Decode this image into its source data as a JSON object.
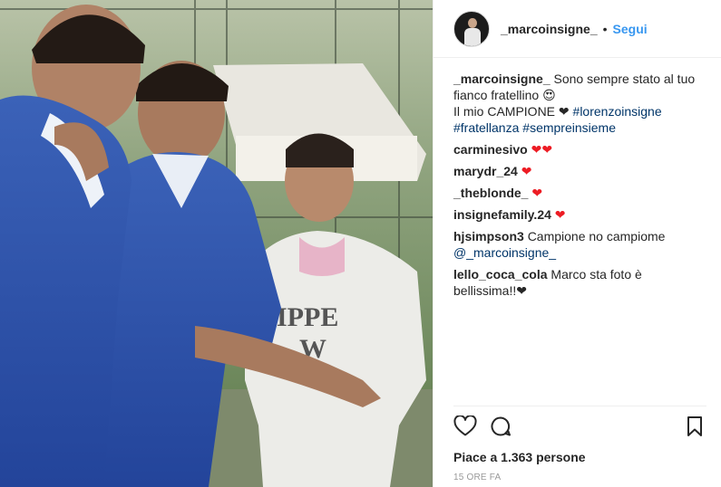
{
  "post": {
    "username": "_marcoinsigne_",
    "separator": "•",
    "follow_label": "Segui"
  },
  "caption": {
    "username": "_marcoinsigne_",
    "text": "Sono sempre stato al tuo fianco fratellino",
    "emoji": "😍",
    "line2_text": "Il mio CAMPIONE",
    "line2_heart": "❤",
    "hashtags": [
      "#lorenzoinsigne",
      "#fratellanza",
      "#sempreinsieme"
    ]
  },
  "comments": [
    {
      "username": "carminesivo",
      "text": "",
      "emoji": "❤❤"
    },
    {
      "username": "marydr_24",
      "text": "",
      "emoji": "❤"
    },
    {
      "username": "_theblonde_",
      "text": "",
      "emoji": "❤"
    },
    {
      "username": "insignefamily.24",
      "text": "",
      "emoji": "❤"
    },
    {
      "username": "hjsimpson3",
      "text": "Campione no campiome",
      "mention": "@_marcoinsigne_"
    },
    {
      "username": "lello_coca_cola",
      "text": "Marco sta foto è bellissima!!❤"
    }
  ],
  "footer": {
    "likes": "Piace a 1.363 persone",
    "time": "15 ORE FA"
  },
  "icons": {
    "like": "heart-outline-icon",
    "comment": "comment-bubble-icon",
    "save": "bookmark-icon"
  }
}
